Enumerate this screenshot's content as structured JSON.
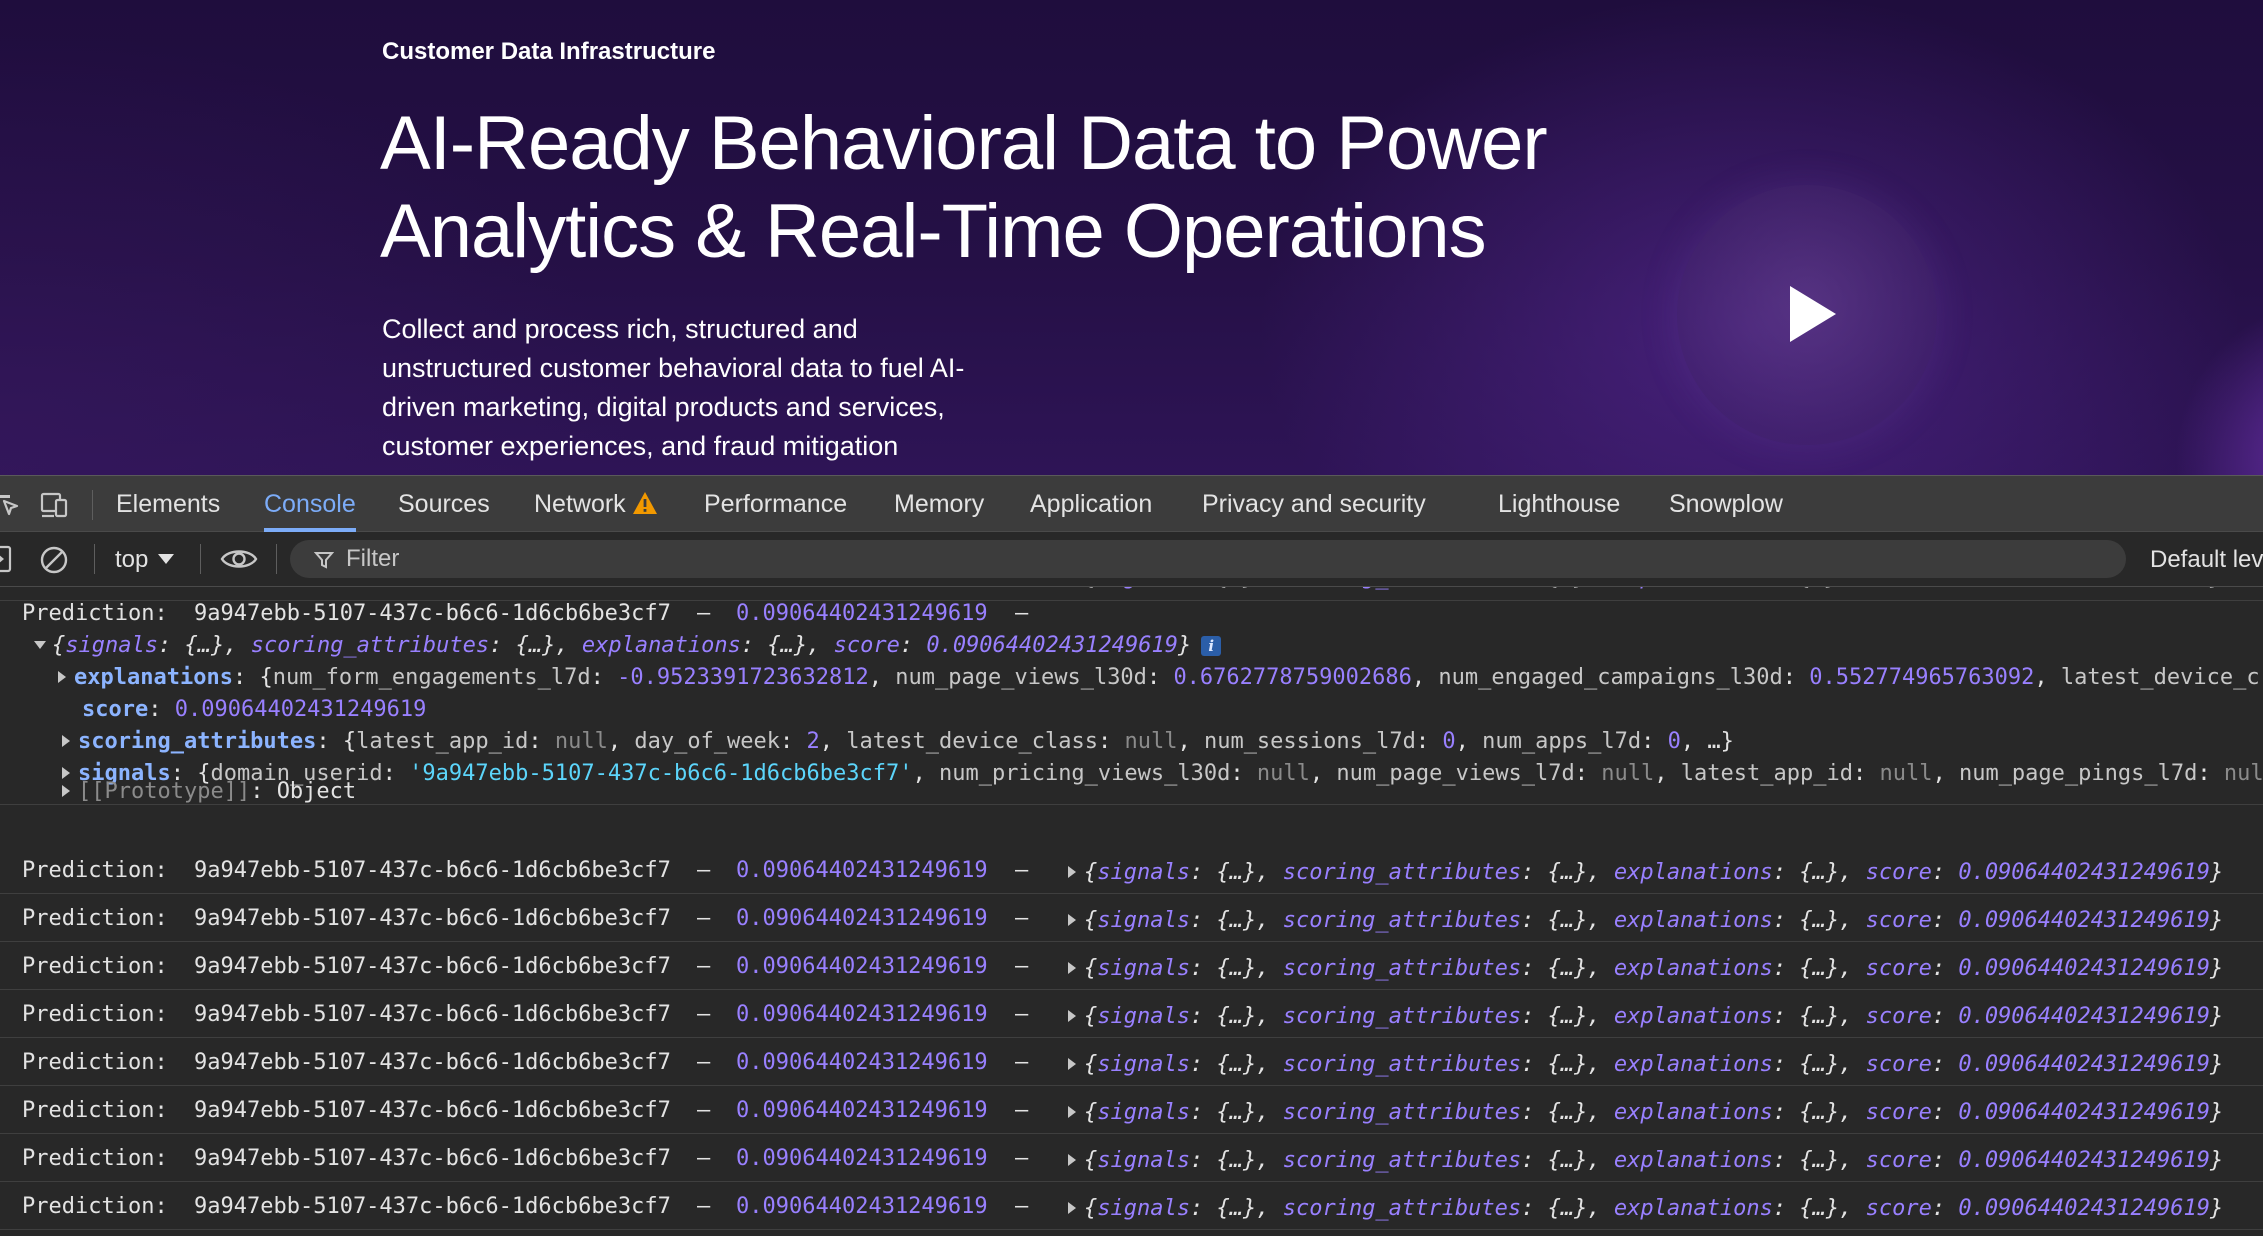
{
  "hero": {
    "eyebrow": "Customer Data Infrastructure",
    "title_line1": "AI-Ready Behavioral Data to Power",
    "title_line2": "Analytics & Real-Time Operations",
    "desc_lines": [
      "Collect and process rich, structured and",
      "unstructured customer behavioral data to fuel AI-",
      "driven marketing, digital products and services,",
      "customer experiences, and fraud mitigation"
    ],
    "play_icon": "play-icon"
  },
  "devtools": {
    "tabs": [
      "Elements",
      "Console",
      "Sources",
      "Network",
      "Performance",
      "Memory",
      "Application",
      "Privacy and security",
      "Lighthouse",
      "Snowplow"
    ],
    "active_tab": "Console",
    "context": "top",
    "filter_placeholder": "Filter",
    "log_level": "Default lev",
    "icons": [
      "inspect-icon",
      "device-toggle-icon",
      "sidebar-toggle-icon",
      "clear-console-icon",
      "eye-icon",
      "filter-icon",
      "warning-icon"
    ]
  },
  "console": {
    "prefix": "Prediction:",
    "user_id": "9a947ebb-5107-437c-b6c6-1d6cb6be3cf7",
    "dash": "–",
    "score": "0.09064402431249619",
    "summary": {
      "open": "{",
      "signals_key": "signals",
      "scoring_key": "scoring_attributes",
      "explanations_key": "explanations",
      "score_key": "score",
      "collapsed": "{…}",
      "close": "}"
    },
    "expanded": {
      "explanations_key": "explanations",
      "num_form_engagements_l7d": "-0.9523391723632812",
      "num_page_views_l30d": "0.6762778759002686",
      "num_engaged_campaigns_l30d": "0.552774965763092",
      "latest_device_trunc": "latest_device_c",
      "score_key": "score",
      "scoring_key": "scoring_attributes",
      "latest_app_id": "null",
      "day_of_week": "2",
      "latest_device_class": "null",
      "num_sessions_l7d": "0",
      "num_apps_l7d": "0",
      "signals_key": "signals",
      "domain_userid": "'9a947ebb-5107-437c-b6c6-1d6cb6be3cf7'",
      "num_pricing_views_l30d": "null",
      "num_page_views_l7d": "null",
      "num_page_pings_l7d_trunc": "nul",
      "prototype": "[[Prototype]]",
      "prototype_value": "Object",
      "info": "i"
    },
    "collapsed_row_count": 8
  }
}
